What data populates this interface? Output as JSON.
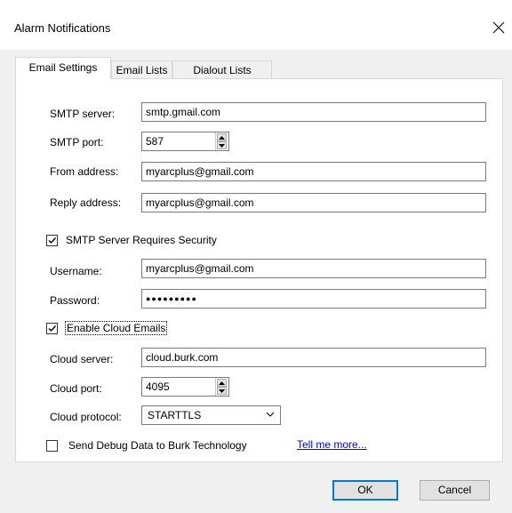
{
  "window": {
    "title": "Alarm Notifications"
  },
  "tabs": [
    {
      "label": "Email Settings",
      "active": true
    },
    {
      "label": "Email Lists",
      "active": false
    },
    {
      "label": "Dialout Lists",
      "active": false
    }
  ],
  "smtp": {
    "server_label": "SMTP server:",
    "server_value": "smtp.gmail.com",
    "port_label": "SMTP port:",
    "port_value": "587",
    "from_label": "From address:",
    "from_value": "myarcplus@gmail.com",
    "reply_label": "Reply address:",
    "reply_value": "myarcplus@gmail.com",
    "requires_security_label": "SMTP Server Requires Security",
    "requires_security_checked": true,
    "username_label": "Username:",
    "username_value": "myarcplus@gmail.com",
    "password_label": "Password:",
    "password_value": "●●●●●●●●●"
  },
  "cloud": {
    "enable_label": "Enable Cloud Emails",
    "enable_checked": true,
    "server_label": "Cloud server:",
    "server_value": "cloud.burk.com",
    "port_label": "Cloud port:",
    "port_value": "4095",
    "protocol_label": "Cloud protocol:",
    "protocol_value": "STARTTLS"
  },
  "debug": {
    "send_label": "Send Debug Data to Burk Technology",
    "send_checked": false,
    "link_label": "Tell me more..."
  },
  "buttons": {
    "ok": "OK",
    "cancel": "Cancel"
  },
  "icons": {
    "close": "close-icon",
    "check": "check-icon",
    "spin": "spin-arrows-icon",
    "chevron": "chevron-down-icon"
  }
}
